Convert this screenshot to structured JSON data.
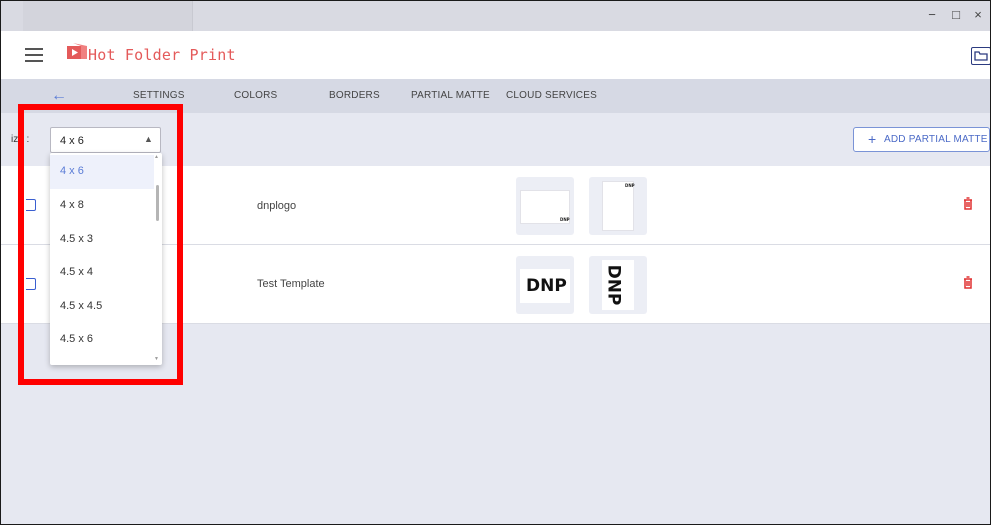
{
  "window": {
    "minimize_glyph": "−",
    "maximize_glyph": "□",
    "close_glyph": "×"
  },
  "app": {
    "title": "Hot Folder Print",
    "logo_icon": "hot-folder-logo-icon",
    "accent_color": "#e45a5a",
    "primary_color": "#5a7cd6"
  },
  "tabs": {
    "back_glyph": "←",
    "items": [
      {
        "label": "SETTINGS"
      },
      {
        "label": "COLORS"
      },
      {
        "label": "BORDERS"
      },
      {
        "label": "PARTIAL MATTE"
      },
      {
        "label": "CLOUD SERVICES"
      }
    ]
  },
  "toolbar": {
    "size_label": "ize :",
    "size_value": "4 x 6",
    "size_caret": "▲",
    "add_plus": "+",
    "add_label": "ADD PARTIAL MATTE"
  },
  "rows": [
    {
      "name": "dnplogo",
      "thumb_small_text": "DNP"
    },
    {
      "name": "Test Template",
      "thumb_large_text": "DNP"
    }
  ],
  "trash_glyph": "🗑",
  "dropdown": {
    "options": [
      "4 x 6",
      "4 x 8",
      "4.5 x 3",
      "4.5 x 4",
      "4.5 x 4.5",
      "4.5 x 6"
    ],
    "selected": "4 x 6",
    "scroll_up_glyph": "▲",
    "scroll_down_glyph": "▼"
  },
  "highlight_color": "#ff0000"
}
